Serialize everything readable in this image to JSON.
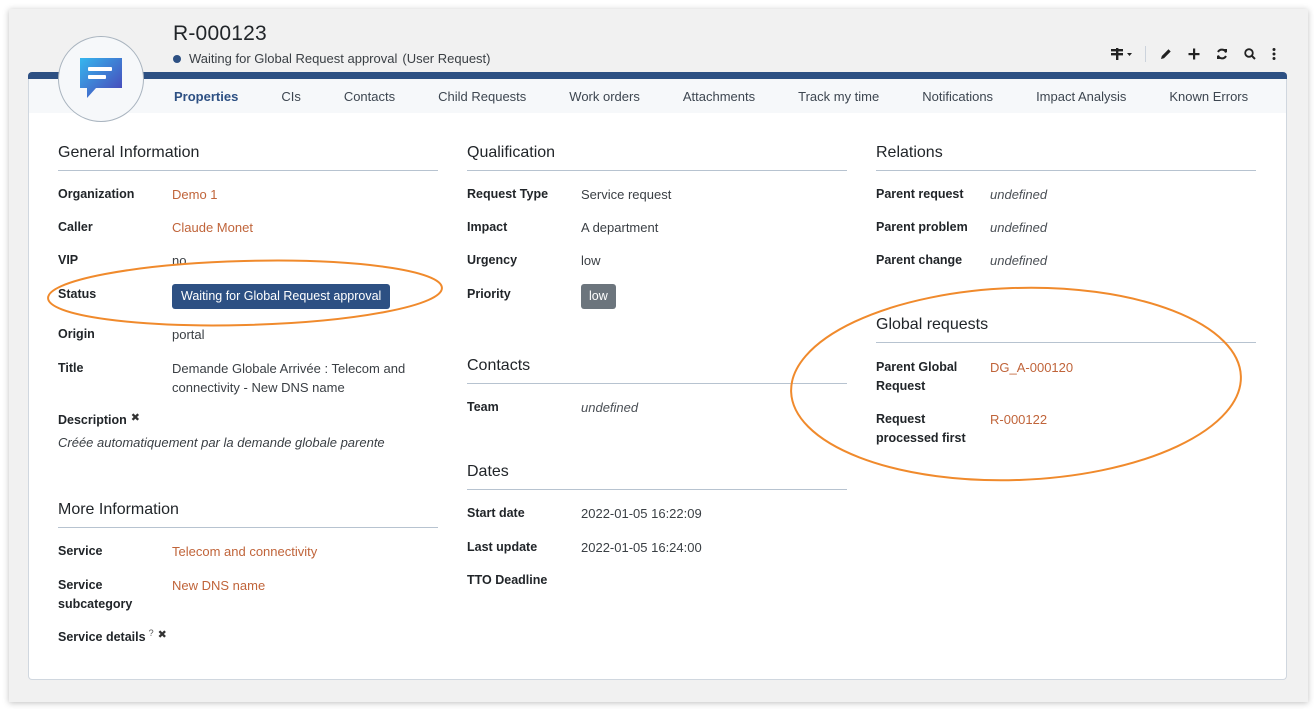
{
  "header": {
    "title": "R-000123",
    "status_text": "Waiting for Global Request approval",
    "type_text": "(User Request)",
    "status_dot_color": "#2d5083"
  },
  "toolbar": {
    "icons": [
      "filter-menu-icon",
      "pencil-icon",
      "plus-icon",
      "refresh-icon",
      "search-icon",
      "more-vertical-icon"
    ]
  },
  "tabs": [
    {
      "label": "Properties",
      "active": true
    },
    {
      "label": "CIs"
    },
    {
      "label": "Contacts"
    },
    {
      "label": "Child Requests"
    },
    {
      "label": "Work orders"
    },
    {
      "label": "Attachments"
    },
    {
      "label": "Track my time"
    },
    {
      "label": "Notifications"
    },
    {
      "label": "Impact Analysis"
    },
    {
      "label": "Known Errors"
    }
  ],
  "general": {
    "title": "General Information",
    "organization_label": "Organization",
    "organization": "Demo 1",
    "caller_label": "Caller",
    "caller": "Claude Monet",
    "vip_label": "VIP",
    "vip": "no",
    "status_label": "Status",
    "status": "Waiting for Global Request approval",
    "origin_label": "Origin",
    "origin": "portal",
    "title_label": "Title",
    "title_line1": "Demande Globale Arrivée : Telecom and",
    "title_line2": "connectivity - New DNS name",
    "description_label": "Description",
    "description": "Créée automatiquement par la demande globale parente"
  },
  "more": {
    "title": "More Information",
    "service_label": "Service",
    "service": "Telecom and connectivity",
    "subcat_label_1": "Service",
    "subcat_label_2": "subcategory",
    "subcat": "New DNS name",
    "details_label": "Service details",
    "help_mark": "?"
  },
  "qualification": {
    "title": "Qualification",
    "type_label": "Request Type",
    "type": "Service request",
    "impact_label": "Impact",
    "impact": "A department",
    "urgency_label": "Urgency",
    "urgency": "low",
    "priority_label": "Priority",
    "priority": "low"
  },
  "contacts": {
    "title": "Contacts",
    "team_label": "Team",
    "team": "undefined"
  },
  "dates": {
    "title": "Dates",
    "start_label": "Start date",
    "start": "2022-01-05 16:22:09",
    "update_label": "Last update",
    "update": "2022-01-05 16:24:00",
    "tto_label": "TTO Deadline"
  },
  "relations": {
    "title": "Relations",
    "parent_request_label": "Parent request",
    "parent_request": "undefined",
    "parent_problem_label": "Parent problem",
    "parent_problem": "undefined",
    "parent_change_label": "Parent change",
    "parent_change": "undefined"
  },
  "global": {
    "title": "Global requests",
    "parent_label_1": "Parent Global",
    "parent_label_2": "Request",
    "parent": "DG_A-000120",
    "first_label_1": "Request",
    "first_label_2": "processed first",
    "first": "R-000122"
  },
  "colors": {
    "primary": "#2d5083",
    "link": "#c0643a",
    "annotation": "#f08a2c",
    "priority_badge": "#6c757d"
  }
}
